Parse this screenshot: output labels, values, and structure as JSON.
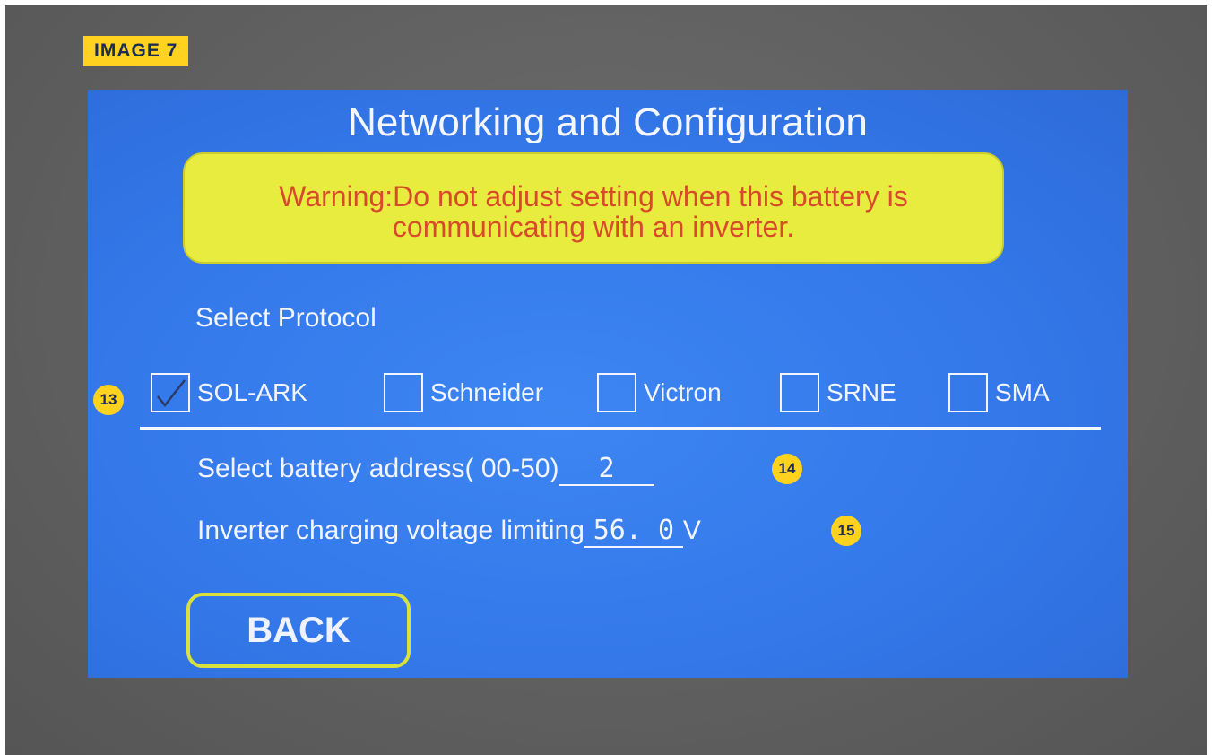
{
  "tag": {
    "label": "IMAGE 7"
  },
  "screen": {
    "title": "Networking and Configuration",
    "warning": {
      "line1": "Warning:Do not adjust setting when this battery is",
      "line2": "communicating with an inverter."
    },
    "protocol_label": "Select Protocol",
    "protocols": [
      {
        "label": "SOL-ARK",
        "checked": true
      },
      {
        "label": "Schneider",
        "checked": false
      },
      {
        "label": "Victron",
        "checked": false
      },
      {
        "label": "SRNE",
        "checked": false
      },
      {
        "label": "SMA",
        "checked": false
      }
    ],
    "battery_address": {
      "label": "Select battery address( 00-50)",
      "value": "2"
    },
    "voltage_limit": {
      "label": "Inverter charging voltage limiting",
      "value": "56. 0",
      "unit": "V"
    },
    "back_label": "BACK"
  },
  "markers": [
    "13",
    "14",
    "15"
  ],
  "colors": {
    "screen_bg": "#3478ea",
    "warning_bg": "#e8ec3e",
    "warning_text": "#d84a2c",
    "marker_bg": "#ffd21f"
  }
}
